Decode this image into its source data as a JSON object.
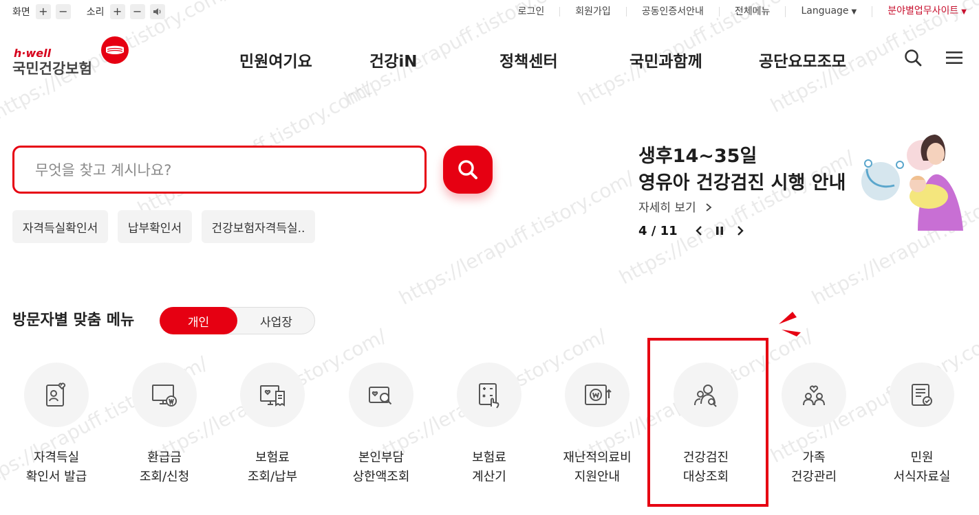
{
  "utility": {
    "screen_label": "화면",
    "sound_label": "소리",
    "links": [
      "로그인",
      "회원가입",
      "공동인증서안내",
      "전체메뉴",
      "Language",
      "분야별업무사이트"
    ]
  },
  "logo": {
    "top": "h·well",
    "name": "국민건강보험"
  },
  "gnb": [
    "민원여기요",
    "건강iN",
    "정책센터",
    "국민과함께",
    "공단요모조모"
  ],
  "search": {
    "placeholder": "무엇을 찾고 계시나요?"
  },
  "quick_chips": [
    "자격득실확인서",
    "납부확인서",
    "건강보험자격득실.."
  ],
  "banner": {
    "line1": "생후14~35일",
    "line2": "영유아 건강검진 시행 안내",
    "more": "자세히 보기",
    "page": "4 / 11"
  },
  "visitor_menu": {
    "title": "방문자별 맞춤 메뉴",
    "tabs": [
      "개인",
      "사업장"
    ],
    "active_tab": "개인",
    "items": [
      {
        "l1": "자격득실",
        "l2": "확인서 발급",
        "icon": "id-card-heart-icon"
      },
      {
        "l1": "환급금",
        "l2": "조회/신청",
        "icon": "monitor-won-icon"
      },
      {
        "l1": "보험료",
        "l2": "조회/납부",
        "icon": "bill-receipt-icon"
      },
      {
        "l1": "본인부담",
        "l2": "상한액조회",
        "icon": "card-search-icon"
      },
      {
        "l1": "보험료",
        "l2": "계산기",
        "icon": "calculator-hand-icon"
      },
      {
        "l1": "재난적의료비",
        "l2": "지원안내",
        "icon": "safe-won-icon"
      },
      {
        "l1": "건강검진",
        "l2": "대상조회",
        "icon": "people-search-icon"
      },
      {
        "l1": "가족",
        "l2": "건강관리",
        "icon": "family-heart-icon"
      },
      {
        "l1": "민원",
        "l2": "서식자료실",
        "icon": "document-check-icon"
      }
    ]
  },
  "watermark": "https://lerapuff.tistory.com/",
  "colors": {
    "accent": "#e60012",
    "text": "#222222",
    "chip_bg": "#f3f3f3"
  }
}
